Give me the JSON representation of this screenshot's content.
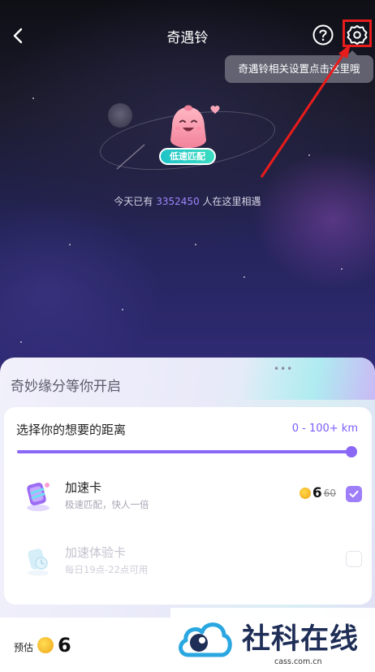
{
  "nav": {
    "title": "奇遇铃"
  },
  "tooltip": {
    "text": "奇遇铃相关设置点击这里哦"
  },
  "hero": {
    "badge": "低速匹配",
    "meet_prefix": "今天已有",
    "meet_count": "3352450",
    "meet_suffix": "人在这里相遇"
  },
  "panel": {
    "title": "奇妙缘分等你开启",
    "distance_label": "选择你的想要的距离",
    "distance_value": "0 - 100+ km",
    "distance_slider_level": 1.0
  },
  "items": [
    {
      "name": "加速卡",
      "desc": "极速匹配，快人一倍",
      "price": "6",
      "old_price": "60",
      "checked": true
    },
    {
      "name": "加速体验卡",
      "desc": "每日19点-22点可用",
      "checked": false
    }
  ],
  "footer": {
    "estimate_label": "预估",
    "estimate_value": "6"
  },
  "watermark": {
    "text": "社科在线",
    "url": "cass.com.cn"
  },
  "colors": {
    "accent": "#8a68f5",
    "highlight": "#e81c1c",
    "badge": "#1ec3c8"
  },
  "icons": [
    "back-icon",
    "help-icon",
    "settings-icon",
    "heart-icon",
    "coin-icon",
    "check-icon",
    "bell-mascot",
    "speed-card-icon",
    "trial-card-icon"
  ]
}
